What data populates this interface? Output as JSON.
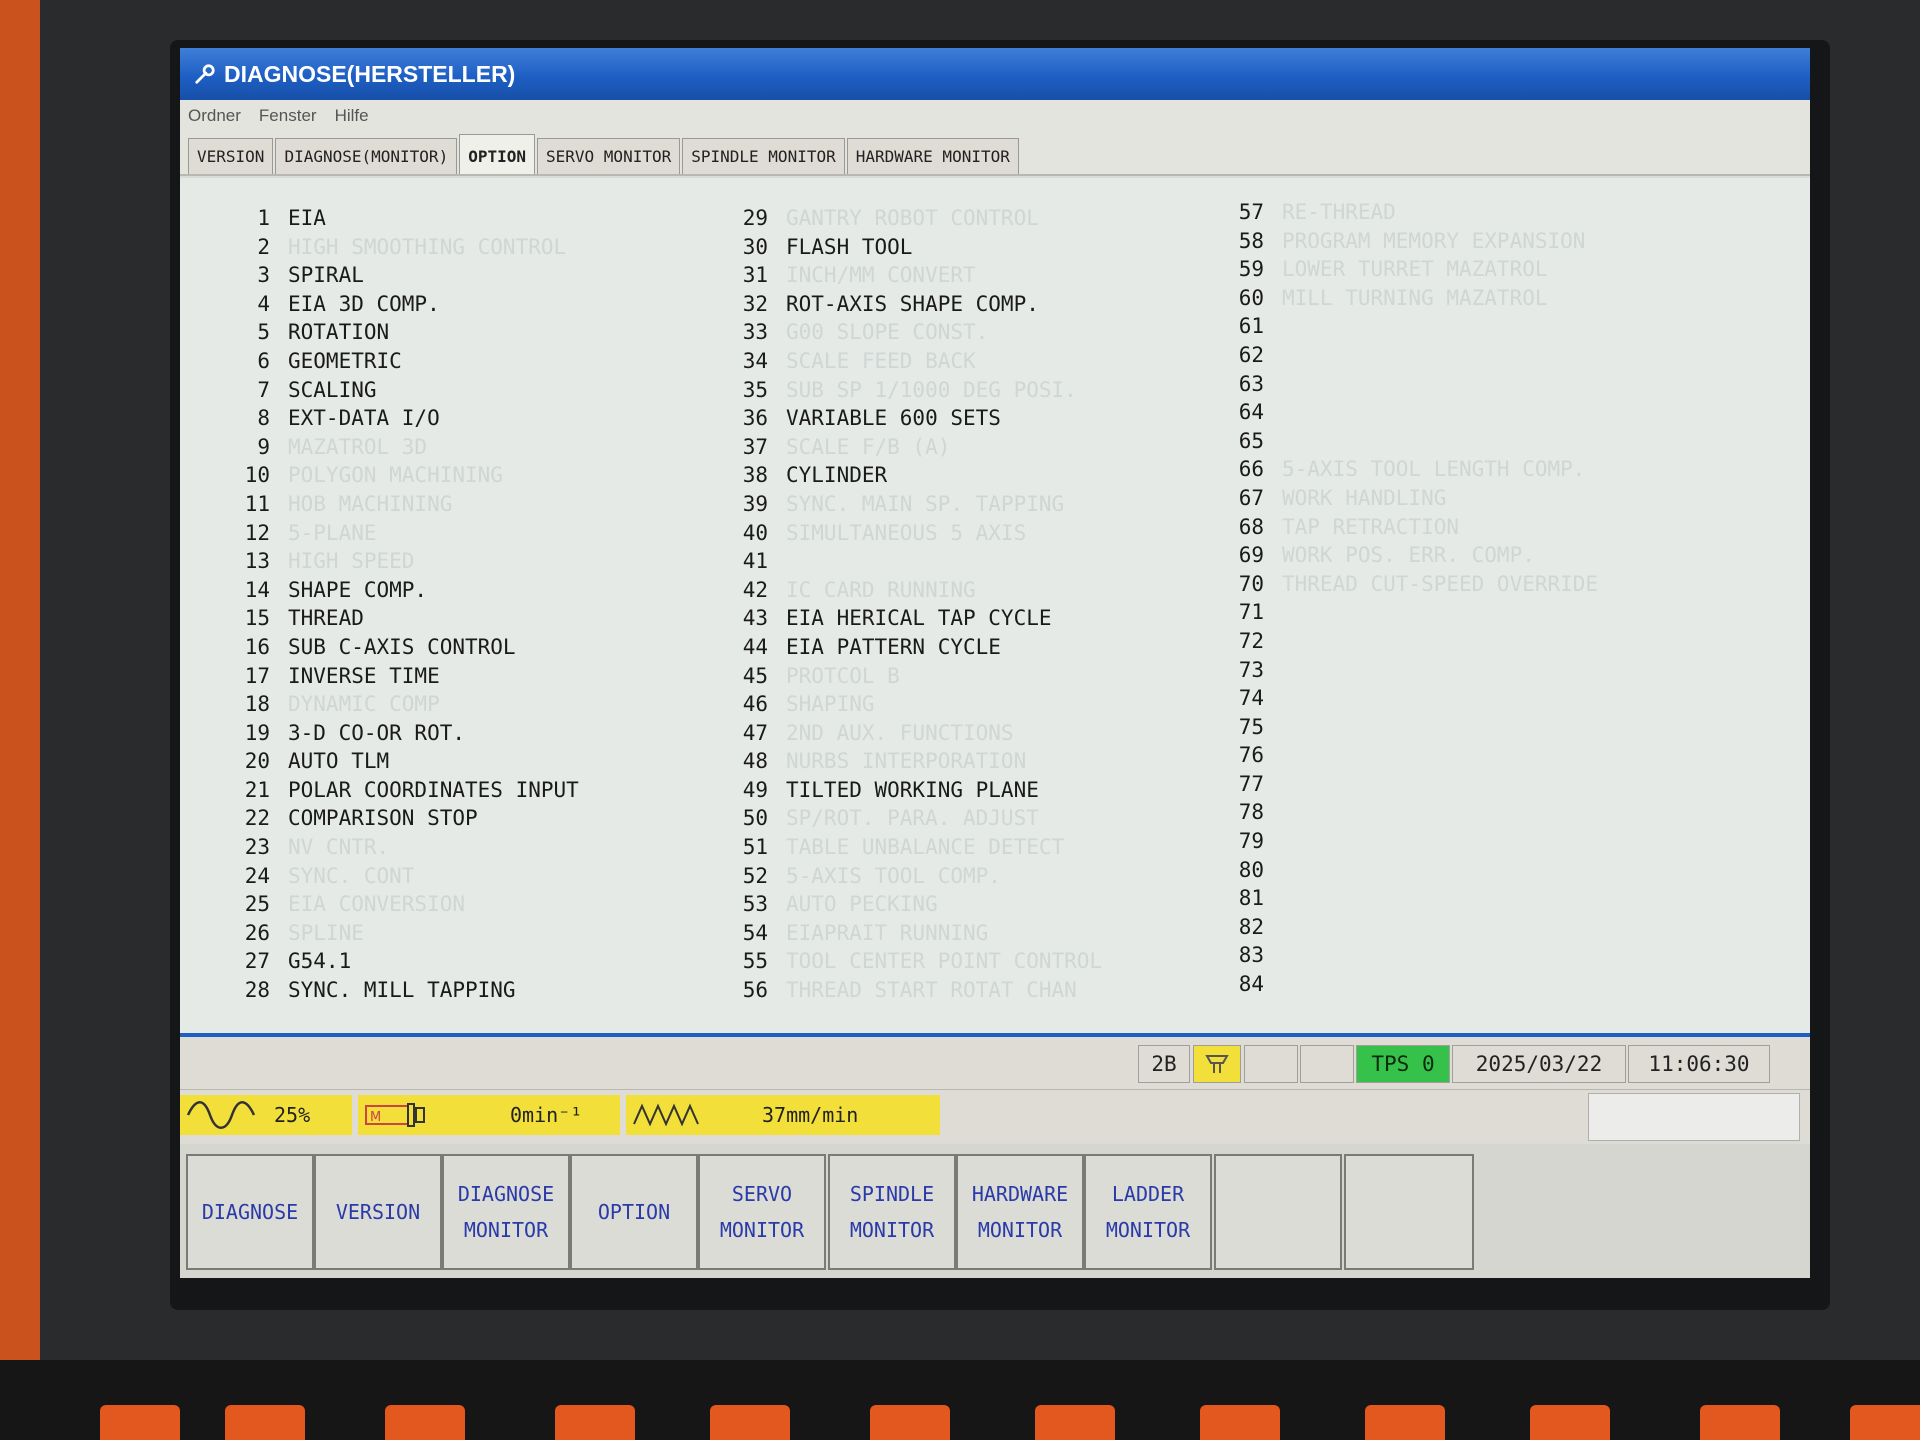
{
  "window": {
    "title": "DIAGNOSE(HERSTELLER)"
  },
  "menu": [
    "Ordner",
    "Fenster",
    "Hilfe"
  ],
  "tabs": [
    {
      "label": "VERSION",
      "active": false
    },
    {
      "label": "DIAGNOSE(MONITOR)",
      "active": false
    },
    {
      "label": "OPTION",
      "active": true
    },
    {
      "label": "SERVO MONITOR",
      "active": false
    },
    {
      "label": "SPINDLE MONITOR",
      "active": false
    },
    {
      "label": "HARDWARE MONITOR",
      "active": false
    }
  ],
  "options": [
    {
      "num": "1",
      "label": "EIA",
      "enabled": true
    },
    {
      "num": "2",
      "label": "HIGH SMOOTHING CONTROL",
      "enabled": false
    },
    {
      "num": "3",
      "label": "SPIRAL",
      "enabled": true
    },
    {
      "num": "4",
      "label": "EIA 3D COMP.",
      "enabled": true
    },
    {
      "num": "5",
      "label": "ROTATION",
      "enabled": true
    },
    {
      "num": "6",
      "label": "GEOMETRIC",
      "enabled": true
    },
    {
      "num": "7",
      "label": "SCALING",
      "enabled": true
    },
    {
      "num": "8",
      "label": "EXT-DATA I/O",
      "enabled": true
    },
    {
      "num": "9",
      "label": "MAZATROL 3D",
      "enabled": false
    },
    {
      "num": "10",
      "label": "POLYGON MACHINING",
      "enabled": false
    },
    {
      "num": "11",
      "label": "HOB MACHINING",
      "enabled": false
    },
    {
      "num": "12",
      "label": "5-PLANE",
      "enabled": false
    },
    {
      "num": "13",
      "label": "HIGH SPEED",
      "enabled": false
    },
    {
      "num": "14",
      "label": "SHAPE COMP.",
      "enabled": true
    },
    {
      "num": "15",
      "label": "THREAD",
      "enabled": true
    },
    {
      "num": "16",
      "label": "SUB C-AXIS CONTROL",
      "enabled": true
    },
    {
      "num": "17",
      "label": "INVERSE TIME",
      "enabled": true
    },
    {
      "num": "18",
      "label": "DYNAMIC COMP",
      "enabled": false
    },
    {
      "num": "19",
      "label": "3-D CO-OR ROT.",
      "enabled": true
    },
    {
      "num": "20",
      "label": "AUTO TLM",
      "enabled": true
    },
    {
      "num": "21",
      "label": "POLAR COORDINATES INPUT",
      "enabled": true
    },
    {
      "num": "22",
      "label": "COMPARISON STOP",
      "enabled": true
    },
    {
      "num": "23",
      "label": "NV CNTR.",
      "enabled": false
    },
    {
      "num": "24",
      "label": "SYNC. CONT",
      "enabled": false
    },
    {
      "num": "25",
      "label": "EIA CONVERSION",
      "enabled": false
    },
    {
      "num": "26",
      "label": "SPLINE",
      "enabled": false
    },
    {
      "num": "27",
      "label": "G54.1",
      "enabled": true
    },
    {
      "num": "28",
      "label": "SYNC. MILL TAPPING",
      "enabled": true
    },
    {
      "num": "29",
      "label": "GANTRY ROBOT CONTROL",
      "enabled": false
    },
    {
      "num": "30",
      "label": "FLASH TOOL",
      "enabled": true
    },
    {
      "num": "31",
      "label": "INCH/MM CONVERT",
      "enabled": false
    },
    {
      "num": "32",
      "label": "ROT-AXIS SHAPE COMP.",
      "enabled": true
    },
    {
      "num": "33",
      "label": "G00 SLOPE CONST.",
      "enabled": false
    },
    {
      "num": "34",
      "label": "SCALE FEED BACK",
      "enabled": false
    },
    {
      "num": "35",
      "label": "SUB SP 1/1000 DEG POSI.",
      "enabled": false
    },
    {
      "num": "36",
      "label": "VARIABLE 600 SETS",
      "enabled": true
    },
    {
      "num": "37",
      "label": "SCALE F/B (A)",
      "enabled": false
    },
    {
      "num": "38",
      "label": "CYLINDER",
      "enabled": true
    },
    {
      "num": "39",
      "label": "SYNC. MAIN SP. TAPPING",
      "enabled": false
    },
    {
      "num": "40",
      "label": "SIMULTANEOUS 5 AXIS",
      "enabled": false
    },
    {
      "num": "41",
      "label": "",
      "enabled": true
    },
    {
      "num": "42",
      "label": "IC CARD RUNNING",
      "enabled": false
    },
    {
      "num": "43",
      "label": "EIA HERICAL TAP CYCLE",
      "enabled": true
    },
    {
      "num": "44",
      "label": "EIA PATTERN CYCLE",
      "enabled": true
    },
    {
      "num": "45",
      "label": "PROTCOL B",
      "enabled": false
    },
    {
      "num": "46",
      "label": "SHAPING",
      "enabled": false
    },
    {
      "num": "47",
      "label": "2ND AUX. FUNCTIONS",
      "enabled": false
    },
    {
      "num": "48",
      "label": "NURBS INTERPORATION",
      "enabled": false
    },
    {
      "num": "49",
      "label": "TILTED WORKING PLANE",
      "enabled": true
    },
    {
      "num": "50",
      "label": "SP/ROT. PARA. ADJUST",
      "enabled": false
    },
    {
      "num": "51",
      "label": "TABLE UNBALANCE DETECT",
      "enabled": false
    },
    {
      "num": "52",
      "label": "5-AXIS TOOL COMP.",
      "enabled": false
    },
    {
      "num": "53",
      "label": "AUTO PECKING",
      "enabled": false
    },
    {
      "num": "54",
      "label": "EIAPRAIT RUNNING",
      "enabled": false
    },
    {
      "num": "55",
      "label": "TOOL CENTER POINT CONTROL",
      "enabled": false
    },
    {
      "num": "56",
      "label": "THREAD START ROTAT CHAN",
      "enabled": false
    },
    {
      "num": "57",
      "label": "RE-THREAD",
      "enabled": false
    },
    {
      "num": "58",
      "label": "PROGRAM MEMORY EXPANSION",
      "enabled": false
    },
    {
      "num": "59",
      "label": "LOWER TURRET MAZATROL",
      "enabled": false
    },
    {
      "num": "60",
      "label": "MILL TURNING MAZATROL",
      "enabled": false
    },
    {
      "num": "61",
      "label": "",
      "enabled": true
    },
    {
      "num": "62",
      "label": "",
      "enabled": true
    },
    {
      "num": "63",
      "label": "",
      "enabled": true
    },
    {
      "num": "64",
      "label": "",
      "enabled": true
    },
    {
      "num": "65",
      "label": "",
      "enabled": true
    },
    {
      "num": "66",
      "label": "5-AXIS TOOL LENGTH COMP.",
      "enabled": false
    },
    {
      "num": "67",
      "label": "WORK HANDLING",
      "enabled": false
    },
    {
      "num": "68",
      "label": "TAP RETRACTION",
      "enabled": false
    },
    {
      "num": "69",
      "label": "WORK POS. ERR. COMP.",
      "enabled": false
    },
    {
      "num": "70",
      "label": "THREAD CUT-SPEED OVERRIDE",
      "enabled": false
    },
    {
      "num": "71",
      "label": "",
      "enabled": true
    },
    {
      "num": "72",
      "label": "",
      "enabled": true
    },
    {
      "num": "73",
      "label": "",
      "enabled": true
    },
    {
      "num": "74",
      "label": "",
      "enabled": true
    },
    {
      "num": "75",
      "label": "",
      "enabled": true
    },
    {
      "num": "76",
      "label": "",
      "enabled": true
    },
    {
      "num": "77",
      "label": "",
      "enabled": true
    },
    {
      "num": "78",
      "label": "",
      "enabled": true
    },
    {
      "num": "79",
      "label": "",
      "enabled": true
    },
    {
      "num": "80",
      "label": "",
      "enabled": true
    },
    {
      "num": "81",
      "label": "",
      "enabled": true
    },
    {
      "num": "82",
      "label": "",
      "enabled": true
    },
    {
      "num": "83",
      "label": "",
      "enabled": true
    },
    {
      "num": "84",
      "label": "",
      "enabled": true
    }
  ],
  "status": {
    "mode_icon": "2B",
    "tps": "TPS 0",
    "date": "2025/03/22",
    "time": "11:06:30"
  },
  "gauges": {
    "override": "25%",
    "spindle": "0min⁻¹",
    "feed": "37mm/min"
  },
  "function_keys": [
    "DIAGNOSE",
    "VERSION",
    "DIAGNOSE\nMONITOR",
    "OPTION",
    "SERVO\nMONITOR",
    "SPINDLE\nMONITOR",
    "HARDWARE\nMONITOR",
    "LADDER\nMONITOR",
    "",
    ""
  ],
  "colors": {
    "title_blue": "#1e5fc4",
    "gauge_yellow": "#f2df3a",
    "tps_green": "#36c24a",
    "fkey_text": "#2a3aa8",
    "bezel_orange": "#e2581f"
  }
}
